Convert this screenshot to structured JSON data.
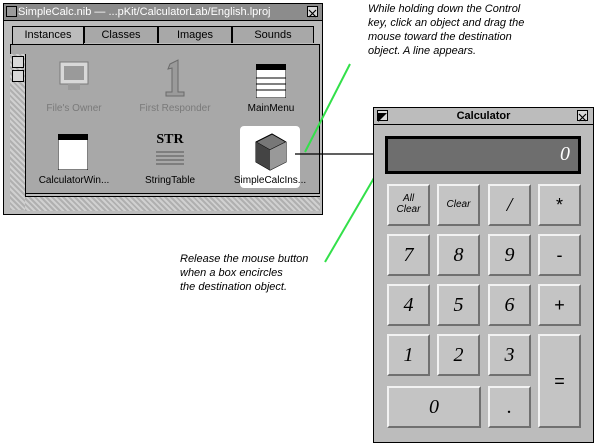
{
  "nib_window": {
    "title": "SimpleCalc.nib — ...pKit/CalculatorLab/English.lproj",
    "tabs": [
      "Instances",
      "Classes",
      "Images",
      "Sounds"
    ],
    "objects": [
      {
        "label": "File's Owner",
        "icon": "window-icon"
      },
      {
        "label": "First Responder",
        "icon": "first-responder-icon"
      },
      {
        "label": "MainMenu",
        "icon": "menu-icon"
      },
      {
        "label": "CalculatorWin...",
        "icon": "window-icon"
      },
      {
        "label": "StringTable",
        "icon": "string-table-icon",
        "icon_text": "STR"
      },
      {
        "label": "SimpleCalcIns...",
        "icon": "cube-icon"
      }
    ]
  },
  "calculator": {
    "title": "Calculator",
    "display_value": "0",
    "keys": {
      "all_clear": [
        "All",
        "Clear"
      ],
      "clear": "Clear",
      "divide": "/",
      "multiply": "*",
      "seven": "7",
      "eight": "8",
      "nine": "9",
      "minus": "-",
      "four": "4",
      "five": "5",
      "six": "6",
      "plus": "+",
      "one": "1",
      "two": "2",
      "three": "3",
      "equals": "=",
      "zero": "0",
      "decimal": "."
    }
  },
  "annotations": {
    "top_lines": [
      "While holding down the Control",
      "key, click an object and drag the",
      "mouse toward the destination",
      "object. A line appears."
    ],
    "bottom_lines": [
      "Release the mouse button",
      "when a box encircles",
      "the destination object."
    ]
  },
  "colors": {
    "connector_line": "#33e04a",
    "window_gray": "#bcbcbc",
    "display": "#6e6e6e"
  }
}
